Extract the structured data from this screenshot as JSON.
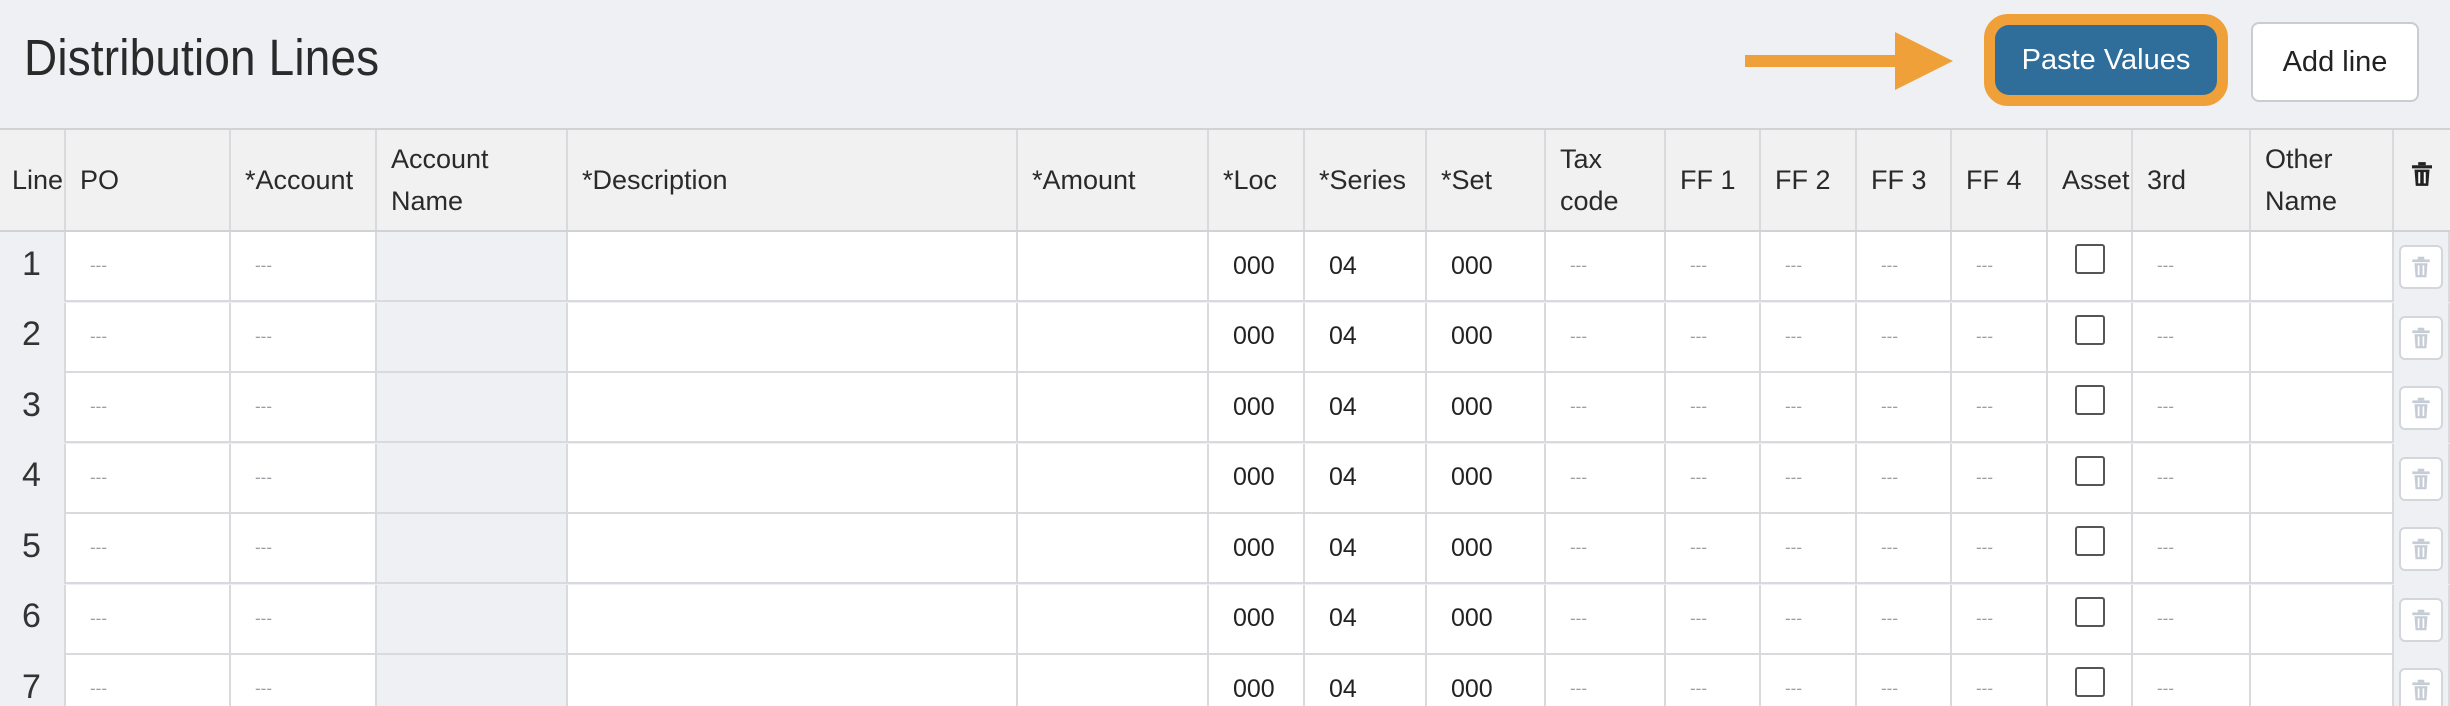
{
  "header": {
    "title": "Distribution Lines",
    "paste_values_label": "Paste Values",
    "add_line_label": "Add line"
  },
  "colors": {
    "accent_orange": "#f0a039",
    "primary_blue": "#2f6d9a",
    "page_bg": "#eff0f3"
  },
  "table": {
    "columns": [
      {
        "key": "line",
        "label": "Line"
      },
      {
        "key": "po",
        "label": "PO"
      },
      {
        "key": "account",
        "label": "*Account"
      },
      {
        "key": "account_name",
        "label": "Account Name"
      },
      {
        "key": "description",
        "label": "*Description"
      },
      {
        "key": "amount",
        "label": "*Amount"
      },
      {
        "key": "loc",
        "label": "*Loc"
      },
      {
        "key": "series",
        "label": "*Series"
      },
      {
        "key": "set",
        "label": "*Set"
      },
      {
        "key": "tax_code",
        "label": "Tax code"
      },
      {
        "key": "ff1",
        "label": "FF 1"
      },
      {
        "key": "ff2",
        "label": "FF 2"
      },
      {
        "key": "ff3",
        "label": "FF 3"
      },
      {
        "key": "ff4",
        "label": "FF 4"
      },
      {
        "key": "asset",
        "label": "Asset"
      },
      {
        "key": "third",
        "label": "3rd"
      },
      {
        "key": "other_name",
        "label": "Other Name"
      },
      {
        "key": "delete",
        "label": "",
        "icon": "trash-icon"
      }
    ],
    "rows": [
      {
        "line": "1",
        "po": "---",
        "account": "---",
        "account_name": "",
        "description": "",
        "amount": "",
        "loc": "000",
        "series": "04",
        "set": "000",
        "tax_code": "---",
        "ff1": "---",
        "ff2": "---",
        "ff3": "---",
        "ff4": "---",
        "asset": false,
        "third": "---",
        "other_name": ""
      },
      {
        "line": "2",
        "po": "---",
        "account": "---",
        "account_name": "",
        "description": "",
        "amount": "",
        "loc": "000",
        "series": "04",
        "set": "000",
        "tax_code": "---",
        "ff1": "---",
        "ff2": "---",
        "ff3": "---",
        "ff4": "---",
        "asset": false,
        "third": "---",
        "other_name": ""
      },
      {
        "line": "3",
        "po": "---",
        "account": "---",
        "account_name": "",
        "description": "",
        "amount": "",
        "loc": "000",
        "series": "04",
        "set": "000",
        "tax_code": "---",
        "ff1": "---",
        "ff2": "---",
        "ff3": "---",
        "ff4": "---",
        "asset": false,
        "third": "---",
        "other_name": ""
      },
      {
        "line": "4",
        "po": "---",
        "account": "---",
        "account_name": "",
        "description": "",
        "amount": "",
        "loc": "000",
        "series": "04",
        "set": "000",
        "tax_code": "---",
        "ff1": "---",
        "ff2": "---",
        "ff3": "---",
        "ff4": "---",
        "asset": false,
        "third": "---",
        "other_name": ""
      },
      {
        "line": "5",
        "po": "---",
        "account": "---",
        "account_name": "",
        "description": "",
        "amount": "",
        "loc": "000",
        "series": "04",
        "set": "000",
        "tax_code": "---",
        "ff1": "---",
        "ff2": "---",
        "ff3": "---",
        "ff4": "---",
        "asset": false,
        "third": "---",
        "other_name": ""
      },
      {
        "line": "6",
        "po": "---",
        "account": "---",
        "account_name": "",
        "description": "",
        "amount": "",
        "loc": "000",
        "series": "04",
        "set": "000",
        "tax_code": "---",
        "ff1": "---",
        "ff2": "---",
        "ff3": "---",
        "ff4": "---",
        "asset": false,
        "third": "---",
        "other_name": ""
      },
      {
        "line": "7",
        "po": "---",
        "account": "---",
        "account_name": "",
        "description": "",
        "amount": "",
        "loc": "000",
        "series": "04",
        "set": "000",
        "tax_code": "---",
        "ff1": "---",
        "ff2": "---",
        "ff3": "---",
        "ff4": "---",
        "asset": false,
        "third": "---",
        "other_name": ""
      }
    ]
  }
}
